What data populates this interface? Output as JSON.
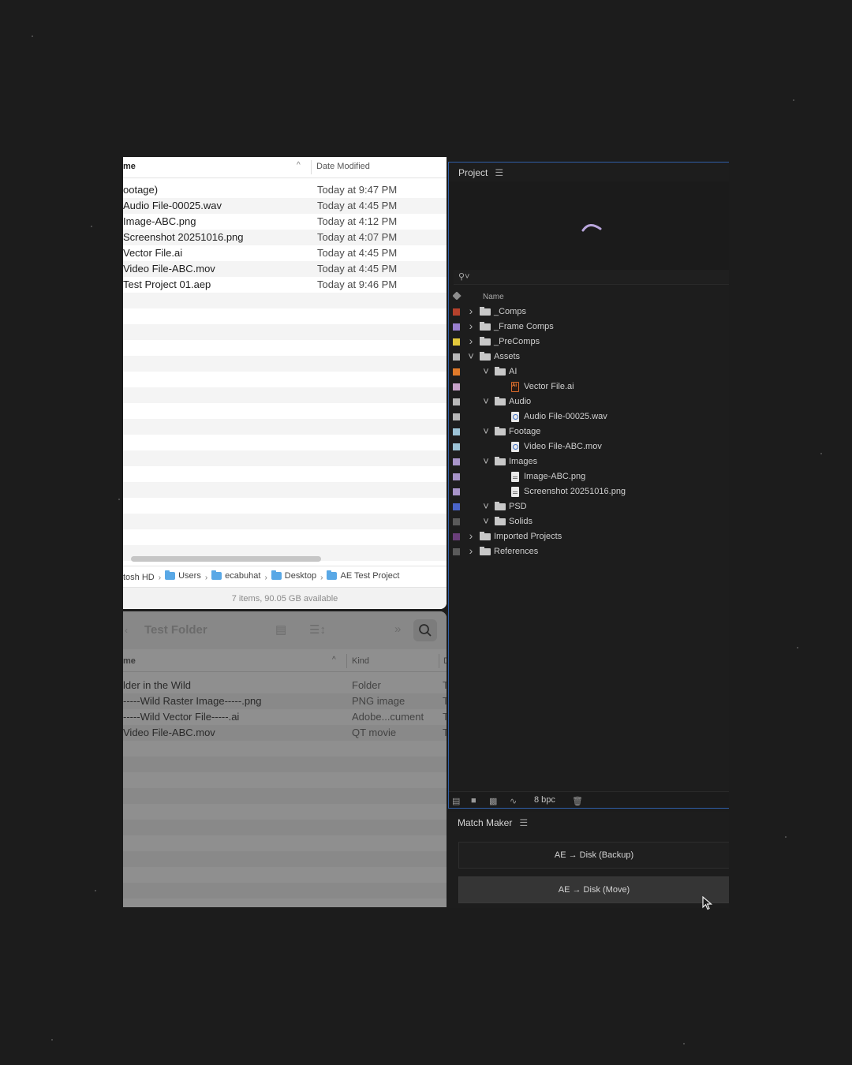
{
  "finder_top": {
    "columns": {
      "name": "me",
      "date": "Date Modified"
    },
    "rows": [
      {
        "name": "ootage)",
        "date": "Today at 9:47 PM"
      },
      {
        "name": "Audio File-00025.wav",
        "date": "Today at 4:45 PM"
      },
      {
        "name": "Image-ABC.png",
        "date": "Today at 4:12 PM"
      },
      {
        "name": "Screenshot 20251016.png",
        "date": "Today at 4:07 PM"
      },
      {
        "name": "Vector File.ai",
        "date": "Today at 4:45 PM"
      },
      {
        "name": "Video File-ABC.mov",
        "date": "Today at 4:45 PM"
      },
      {
        "name": " Test Project 01.aep",
        "date": "Today at 9:46 PM"
      }
    ],
    "path": [
      "tosh HD",
      "Users",
      "ecabuhat",
      "Desktop",
      "AE Test Project"
    ],
    "status": "7 items, 90.05 GB available"
  },
  "finder_bottom": {
    "title": "Test Folder",
    "columns": {
      "name": "me",
      "kind": "Kind",
      "extra": "D"
    },
    "rows": [
      {
        "name": "lder in the Wild",
        "kind": "Folder",
        "extra": "T"
      },
      {
        "name": "-----Wild Raster Image-----.png",
        "kind": "PNG image",
        "extra": "T"
      },
      {
        "name": "-----Wild Vector File-----.ai",
        "kind": "Adobe...cument",
        "extra": "T"
      },
      {
        "name": "Video File-ABC.mov",
        "kind": "QT movie",
        "extra": "T"
      }
    ]
  },
  "project": {
    "title": "Project",
    "search_placeholder": "",
    "name_header": "Name",
    "tree": [
      {
        "label_color": "#b5412c",
        "depth": 0,
        "twisty": "right",
        "type": "folder",
        "name": "_Comps"
      },
      {
        "label_color": "#9a7fcf",
        "depth": 0,
        "twisty": "right",
        "type": "folder",
        "name": "_Frame Comps"
      },
      {
        "label_color": "#e3c83c",
        "depth": 0,
        "twisty": "right",
        "type": "folder",
        "name": "_PreComps"
      },
      {
        "label_color": "#b8b8b8",
        "depth": 0,
        "twisty": "down",
        "type": "folder",
        "name": "Assets"
      },
      {
        "label_color": "#e07a2a",
        "depth": 1,
        "twisty": "down",
        "type": "folder",
        "name": "AI"
      },
      {
        "label_color": "#c7a3c9",
        "depth": 2,
        "twisty": "none",
        "type": "ai",
        "name": "Vector File.ai"
      },
      {
        "label_color": "#b8b8b8",
        "depth": 1,
        "twisty": "down",
        "type": "folder",
        "name": "Audio"
      },
      {
        "label_color": "#b8b8b8",
        "depth": 2,
        "twisty": "none",
        "type": "audio",
        "name": "Audio File-00025.wav"
      },
      {
        "label_color": "#9cc3d6",
        "depth": 1,
        "twisty": "down",
        "type": "folder",
        "name": "Footage"
      },
      {
        "label_color": "#9cc3d6",
        "depth": 2,
        "twisty": "none",
        "type": "video",
        "name": "Video File-ABC.mov"
      },
      {
        "label_color": "#a894c9",
        "depth": 1,
        "twisty": "down",
        "type": "folder",
        "name": "Images"
      },
      {
        "label_color": "#a894c9",
        "depth": 2,
        "twisty": "none",
        "type": "img",
        "name": "Image-ABC.png"
      },
      {
        "label_color": "#a894c9",
        "depth": 2,
        "twisty": "none",
        "type": "img",
        "name": "Screenshot 20251016.png"
      },
      {
        "label_color": "#4a64c9",
        "depth": 1,
        "twisty": "down",
        "type": "folder",
        "name": "PSD"
      },
      {
        "label_color": "#5a5a5a",
        "depth": 1,
        "twisty": "down",
        "type": "folder",
        "name": "Solids"
      },
      {
        "label_color": "#6a3f7a",
        "depth": 0,
        "twisty": "right",
        "type": "folder",
        "name": "Imported Projects"
      },
      {
        "label_color": "#5a5a5a",
        "depth": 0,
        "twisty": "right",
        "type": "folder",
        "name": "References"
      }
    ],
    "footer": {
      "bpc": "8 bpc"
    }
  },
  "match_maker": {
    "title": "Match Maker",
    "buttons": [
      "AE → Disk (Backup)",
      "AE → Disk (Move)"
    ]
  },
  "colors": {
    "accent_border": "#2f5fa8",
    "background": "#1c1c1c"
  }
}
